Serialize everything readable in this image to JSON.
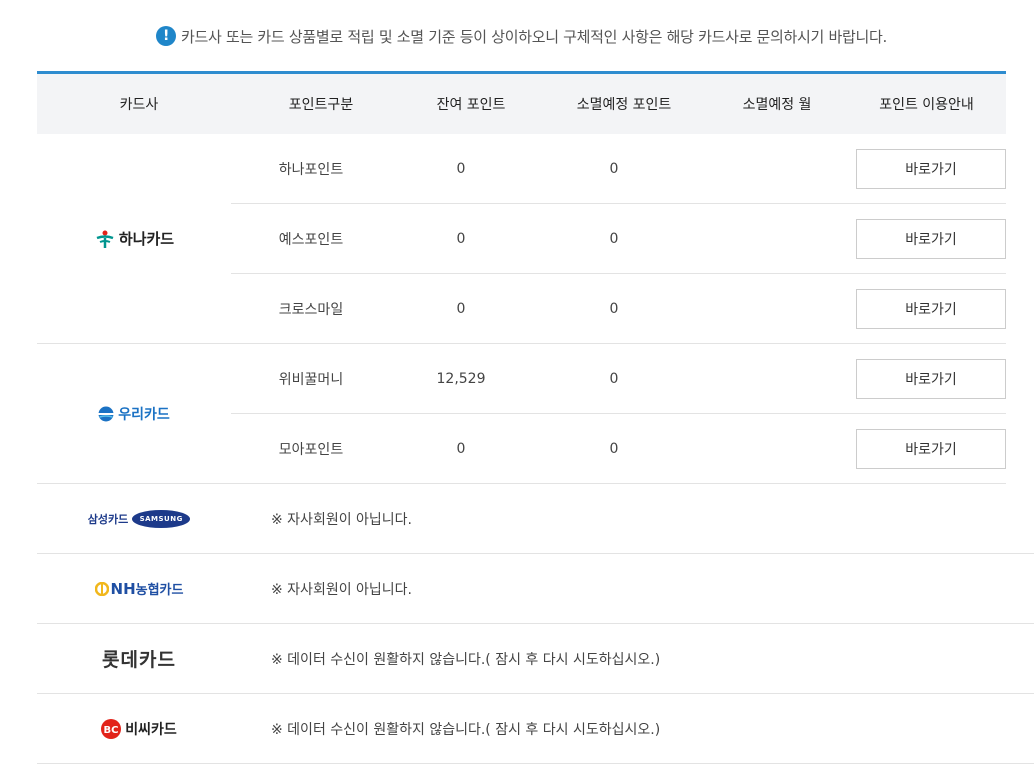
{
  "notice": {
    "icon": "!",
    "text": "카드사 또는 카드 상품별로 적립 및 소멸 기준 등이 상이하오니 구체적인 사항은 해당 카드사로 문의하시기 바랍니다."
  },
  "headers": [
    "카드사",
    "포인트구분",
    "잔여 포인트",
    "소멸예정 포인트",
    "소멸예정 월",
    "포인트 이용안내"
  ],
  "hana": {
    "logo_text": "하나카드",
    "rows": [
      {
        "type": "하나포인트",
        "remaining": "0",
        "expiring": "0",
        "month": "",
        "button": "바로가기"
      },
      {
        "type": "예스포인트",
        "remaining": "0",
        "expiring": "0",
        "month": "",
        "button": "바로가기"
      },
      {
        "type": "크로스마일",
        "remaining": "0",
        "expiring": "0",
        "month": "",
        "button": "바로가기"
      }
    ]
  },
  "woori": {
    "logo_text": "우리카드",
    "rows": [
      {
        "type": "위비꿀머니",
        "remaining": "12,529",
        "expiring": "0",
        "month": "",
        "button": "바로가기"
      },
      {
        "type": "모아포인트",
        "remaining": "0",
        "expiring": "0",
        "month": "",
        "button": "바로가기"
      }
    ]
  },
  "samsung": {
    "logo_text": "삼성카드",
    "logo_badge": "SAMSUNG",
    "message": "※ 자사회원이 아닙니다."
  },
  "nh": {
    "logo_main": "NH",
    "logo_sub": "농협카드",
    "message": "※ 자사회원이 아닙니다."
  },
  "lotte": {
    "logo_text": "롯데카드",
    "message": "※ 데이터 수신이 원활하지 않습니다.( 잠시 후 다시 시도하십시오.)"
  },
  "bc": {
    "logo_badge": "BC",
    "logo_text": "비씨카드",
    "message": "※ 데이터 수신이 원활하지 않습니다.( 잠시 후 다시 시도하십시오.)"
  },
  "colors": {
    "accent": "#2e8ccf",
    "header_bg": "#f3f4f6",
    "hana_green": "#00958f",
    "woori_blue": "#1b72c4",
    "samsung_navy": "#1d3a8a",
    "nh_blue": "#1f4fa3",
    "nh_yellow": "#f1b71c",
    "bc_red": "#e2231a"
  }
}
